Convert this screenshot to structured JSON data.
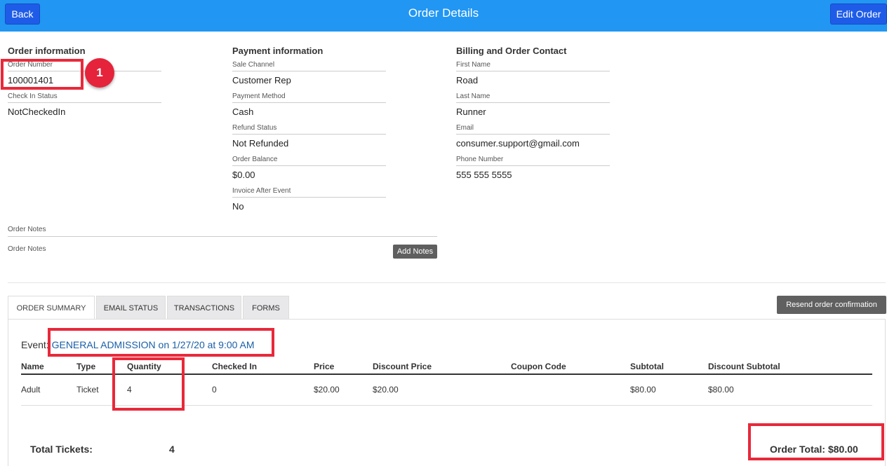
{
  "header": {
    "title": "Order Details",
    "back_label": "Back",
    "edit_label": "Edit Order"
  },
  "order_info": {
    "heading": "Order information",
    "fields": [
      {
        "label": "Order Number",
        "value": "100001401"
      },
      {
        "label": "Check In Status",
        "value": "NotCheckedIn"
      }
    ]
  },
  "payment_info": {
    "heading": "Payment information",
    "fields": [
      {
        "label": "Sale Channel",
        "value": "Customer Rep"
      },
      {
        "label": "Payment Method",
        "value": "Cash"
      },
      {
        "label": "Refund Status",
        "value": "Not Refunded"
      },
      {
        "label": "Order Balance",
        "value": "$0.00"
      },
      {
        "label": "Invoice After Event",
        "value": "No"
      }
    ]
  },
  "billing_info": {
    "heading": "Billing and Order Contact",
    "fields": [
      {
        "label": "First Name",
        "value": "Road"
      },
      {
        "label": "Last Name",
        "value": "Runner"
      },
      {
        "label": "Email",
        "value": "consumer.support@gmail.com"
      },
      {
        "label": "Phone Number",
        "value": "555 555 5555"
      }
    ]
  },
  "notes": {
    "section_label": "Order Notes",
    "label": "Order Notes",
    "add_button": "Add Notes"
  },
  "tabs": [
    {
      "label": "ORDER SUMMARY",
      "active": true
    },
    {
      "label": "EMAIL STATUS",
      "active": false
    },
    {
      "label": "TRANSACTIONS",
      "active": false
    },
    {
      "label": "FORMS",
      "active": false
    }
  ],
  "resend_button": "Resend order confirmation",
  "summary": {
    "event_prefix": "Event:",
    "event_link": "GENERAL ADMISSION on 1/27/20 at 9:00 AM",
    "columns": [
      "Name",
      "Type",
      "Quantity",
      "Checked In",
      "Price",
      "Discount Price",
      "Coupon Code",
      "Subtotal",
      "Discount Subtotal"
    ],
    "rows": [
      [
        "Adult",
        "Ticket",
        "4",
        "0",
        "$20.00",
        "$20.00",
        "",
        "$80.00",
        "$80.00"
      ]
    ],
    "total_tickets_label": "Total Tickets:",
    "total_tickets_value": "4",
    "order_total": "Order Total: $80.00"
  },
  "annotation": {
    "badge_number": "1",
    "highlight_color": "#e8293a"
  },
  "colors": {
    "header_bg": "#2196f3",
    "primary_button": "#1e5ce8",
    "link": "#1a5fa8"
  }
}
